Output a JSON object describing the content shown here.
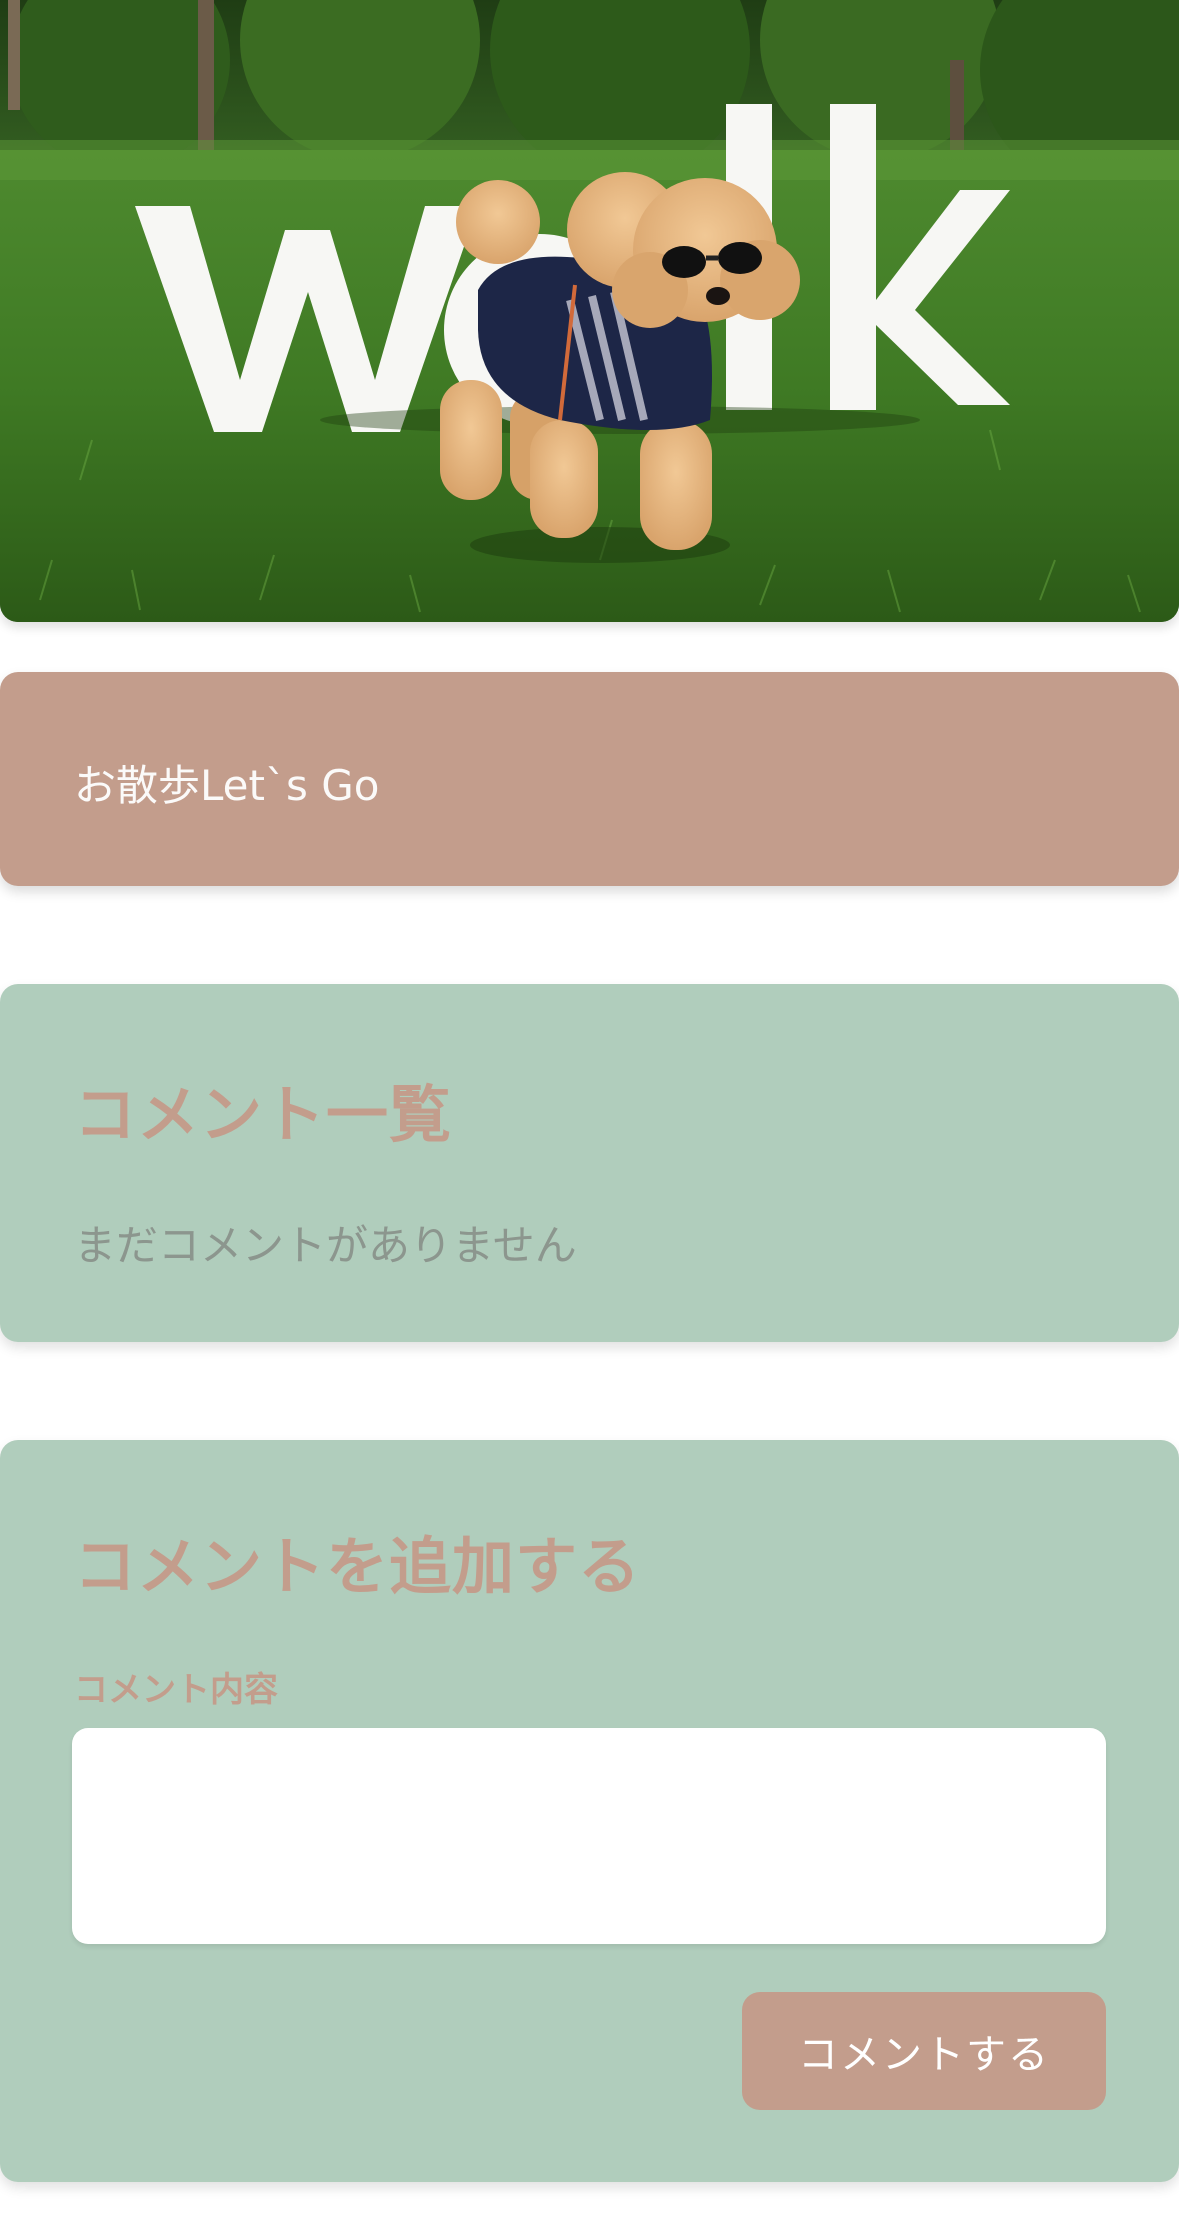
{
  "hero": {
    "image_alt": "poodle",
    "overlay_word": "walk"
  },
  "post": {
    "title": "お散歩Let`s Go"
  },
  "comments": {
    "heading": "コメント一覧",
    "empty_message": "まだコメントがありません"
  },
  "add_comment": {
    "heading": "コメントを追加する",
    "field_label": "コメント内容",
    "input_value": "",
    "submit_label": "コメントする"
  },
  "colors": {
    "accent": "#c39d8c",
    "card_green": "#b0cdbc",
    "muted_text": "#8c968e"
  }
}
